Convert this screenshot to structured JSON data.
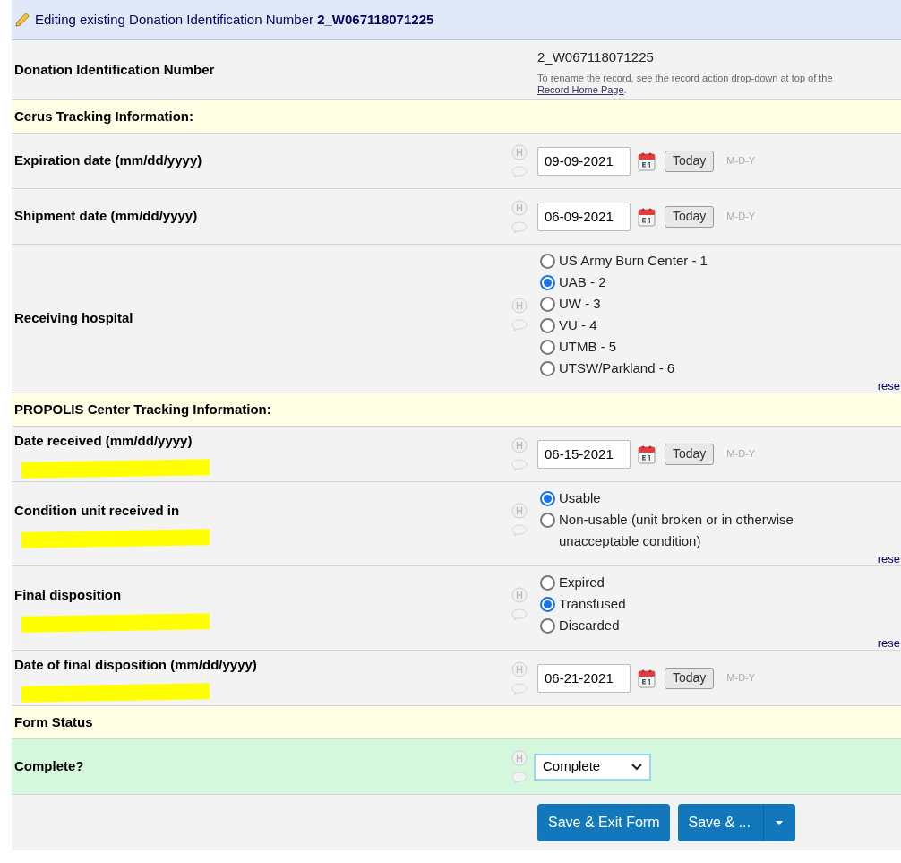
{
  "header": {
    "text": "Editing existing Donation Identification Number **2_W067118071225**"
  },
  "rows": [
    {
      "kind": "identifier",
      "label": "Donation Identification Number",
      "value": "2_W067118071225",
      "note": "To rename the record, see the record action drop-down at top of the",
      "link": "Record Home Page",
      "after_link": "."
    },
    {
      "kind": "section",
      "label": "Cerus Tracking Information:"
    },
    {
      "kind": "date",
      "label": "Expiration date (mm/dd/yyyy)",
      "value": "09-09-2021",
      "button": "Today",
      "format": "M-D-Y"
    },
    {
      "kind": "date",
      "label": "Shipment date (mm/dd/yyyy)",
      "value": "06-09-2021",
      "button": "Today",
      "format": "M-D-Y"
    },
    {
      "kind": "radio",
      "label": "Receiving hospital",
      "reset": "rese",
      "options": [
        {
          "label": "US Army Burn Center - 1",
          "selected": false
        },
        {
          "label": "UAB - 2",
          "selected": true
        },
        {
          "label": "UW - 3",
          "selected": false
        },
        {
          "label": "VU - 4",
          "selected": false
        },
        {
          "label": "UTMB - 5",
          "selected": false
        },
        {
          "label": "UTSW/Parkland - 6",
          "selected": false
        }
      ]
    },
    {
      "kind": "section",
      "label": "PROPOLIS Center Tracking Information:"
    },
    {
      "kind": "date",
      "label": "Date received (mm/dd/yyyy)",
      "marked": true,
      "value": "06-15-2021",
      "button": "Today",
      "format": "M-D-Y"
    },
    {
      "kind": "radio",
      "label": "Condition unit received in",
      "marked": true,
      "reset": "rese",
      "options": [
        {
          "label": "Usable",
          "selected": true
        },
        {
          "label": "Non-usable (unit broken or in otherwise unacceptable condition)",
          "selected": false
        }
      ]
    },
    {
      "kind": "radio",
      "label": "Final disposition",
      "marked": true,
      "reset": "rese",
      "options": [
        {
          "label": "Expired",
          "selected": false
        },
        {
          "label": "Transfused",
          "selected": true
        },
        {
          "label": "Discarded",
          "selected": false
        }
      ]
    },
    {
      "kind": "date",
      "label": "Date of final disposition (mm/dd/yyyy)",
      "marked": true,
      "value": "06-21-2021",
      "button": "Today",
      "format": "M-D-Y"
    },
    {
      "kind": "section",
      "label": "Form Status"
    },
    {
      "kind": "select",
      "label": "Complete?",
      "value": "Complete"
    }
  ],
  "buttons": {
    "primary": "Save & Exit Form",
    "secondary": "Save & ..."
  }
}
